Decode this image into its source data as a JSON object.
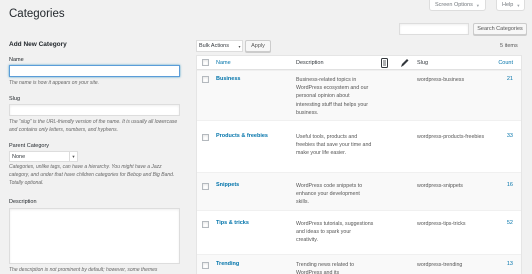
{
  "page": {
    "title": "Categories"
  },
  "top_buttons": {
    "screen_options": "Screen Options",
    "help": "Help"
  },
  "search": {
    "placeholder": "",
    "button": "Search Categories"
  },
  "form": {
    "heading": "Add New Category",
    "name_label": "Name",
    "name_value": "",
    "name_help": "The name is how it appears on your site.",
    "slug_label": "Slug",
    "slug_value": "",
    "slug_help": "The “slug” is the URL-friendly version of the name. It is usually all lowercase and contains only letters, numbers, and hyphens.",
    "parent_label": "Parent Category",
    "parent_value": "None",
    "parent_help": "Categories, unlike tags, can have a hierarchy. You might have a Jazz category, and under that have children categories for Bebop and Big Band. Totally optional.",
    "description_label": "Description",
    "description_value": "",
    "description_help": "The description is not prominent by default; however, some themes"
  },
  "bulk": {
    "selected": "Bulk Actions",
    "apply": "Apply"
  },
  "items_count": "5 items",
  "table": {
    "headers": {
      "name": "Name",
      "description": "Description",
      "slug": "Slug",
      "count": "Count"
    },
    "rows": [
      {
        "name": "Business",
        "description": "Business-related topics in WordPress ecosystem and our personal opinion about interesting stuff that helps your business.",
        "slug": "wordpress-business",
        "count": "21"
      },
      {
        "name": "Products & freebies",
        "description": "Useful tools, products and freebies that save your time and make your life easier.",
        "slug": "wordpress-products-freebies",
        "count": "33"
      },
      {
        "name": "Snippets",
        "description": "WordPress code snippets to enhance your development skills.",
        "slug": "wordpress-snippets",
        "count": "16"
      },
      {
        "name": "Tips & tricks",
        "description": "WordPress tutorials, suggestions and ideas to spark your creativity.",
        "slug": "wordpress-tips-tricks",
        "count": "52"
      },
      {
        "name": "Trending",
        "description": "Trending news related to WordPress and its",
        "slug": "wordpress-trending",
        "count": "13"
      }
    ]
  },
  "colors": {
    "link": "#0073aa",
    "background": "#f1f1f1",
    "focus": "#5b9dd9"
  }
}
